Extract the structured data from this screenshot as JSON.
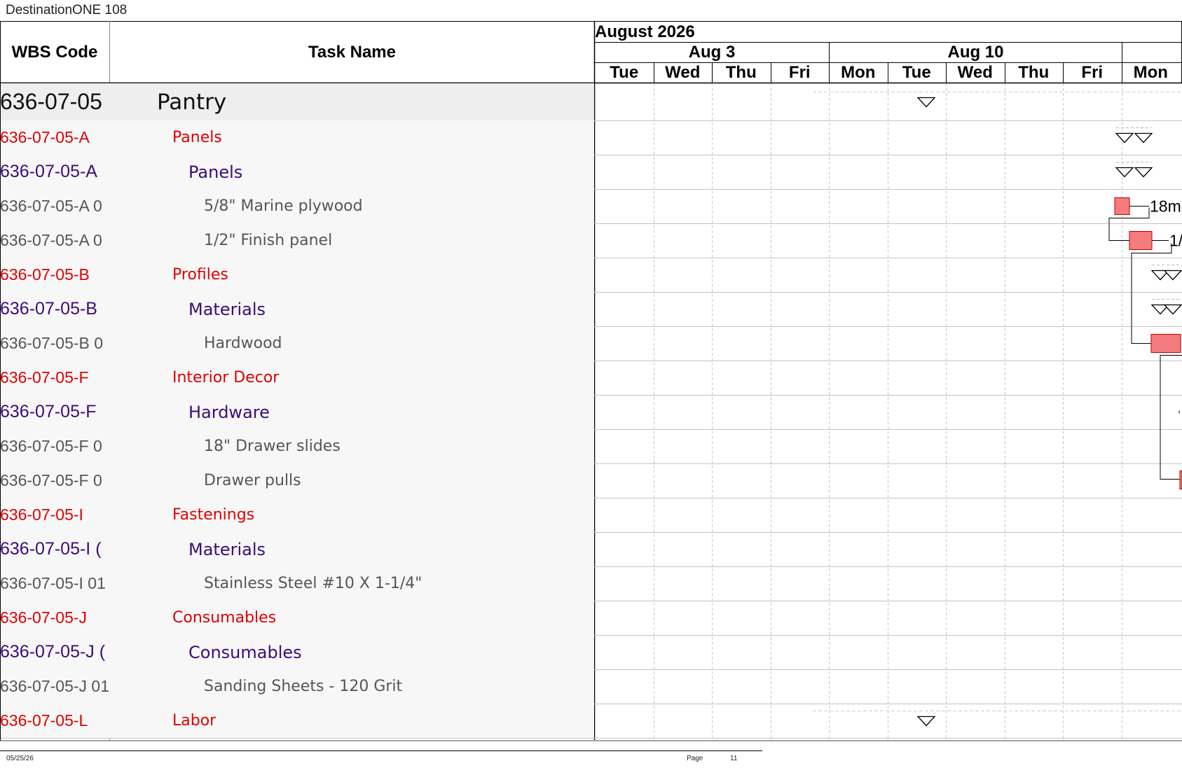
{
  "app": {
    "title": "DestinationONE 108"
  },
  "columns": {
    "wbs_header": "WBS Code",
    "task_header": "Task Name"
  },
  "timescale": {
    "month": "August 2026",
    "weeks": [
      "Aug 3",
      "Aug 10"
    ],
    "days": [
      "Tue",
      "Wed",
      "Thu",
      "Fri",
      "Mon",
      "Tue",
      "Wed",
      "Thu",
      "Fri",
      "Mon"
    ]
  },
  "rows": [
    {
      "wbs": "636-07-05",
      "task": "Pantry",
      "level": 0
    },
    {
      "wbs": "636-07-05-A",
      "task": "Panels",
      "level": 1
    },
    {
      "wbs": "636-07-05-A",
      "task": "Panels",
      "level": 2
    },
    {
      "wbs": "636-07-05-A 0",
      "task": "5/8\" Marine plywood",
      "level": 3
    },
    {
      "wbs": "636-07-05-A 0",
      "task": "1/2\" Finish panel",
      "level": 3
    },
    {
      "wbs": "636-07-05-B",
      "task": "Profiles",
      "level": 1
    },
    {
      "wbs": "636-07-05-B",
      "task": "Materials",
      "level": 2
    },
    {
      "wbs": "636-07-05-B 0",
      "task": "Hardwood",
      "level": 3
    },
    {
      "wbs": "636-07-05-F",
      "task": "Interior Decor",
      "level": 1
    },
    {
      "wbs": "636-07-05-F",
      "task": "Hardware",
      "level": 2
    },
    {
      "wbs": "636-07-05-F 0",
      "task": "18\" Drawer slides",
      "level": 3
    },
    {
      "wbs": "636-07-05-F 0",
      "task": "Drawer pulls",
      "level": 3
    },
    {
      "wbs": "636-07-05-I",
      "task": "Fastenings",
      "level": 1
    },
    {
      "wbs": "636-07-05-I (",
      "task": "Materials",
      "level": 2
    },
    {
      "wbs": "636-07-05-I 01",
      "task": "Stainless Steel #10 X 1-1/4\"",
      "level": 3
    },
    {
      "wbs": "636-07-05-J",
      "task": "Consumables",
      "level": 1
    },
    {
      "wbs": "636-07-05-J (",
      "task": "Consumables",
      "level": 2
    },
    {
      "wbs": "636-07-05-J 01",
      "task": "Sanding Sheets - 120 Grit",
      "level": 3
    },
    {
      "wbs": "636-07-05-L",
      "task": "Labor",
      "level": 1
    }
  ],
  "bar_labels": {
    "plywood": "18m",
    "finish_panel": "1/"
  },
  "footer": {
    "date": "05/25/26",
    "page_label": "Page",
    "page_number": "11"
  },
  "colors": {
    "task_bar": "#f47c7c",
    "level0_text": "#111111",
    "level1_text": "#e00000",
    "level2_text": "#3d0c78",
    "level3_text": "#555555",
    "row_band": "#f7f7f7",
    "summary_band": "#eeeeee"
  }
}
